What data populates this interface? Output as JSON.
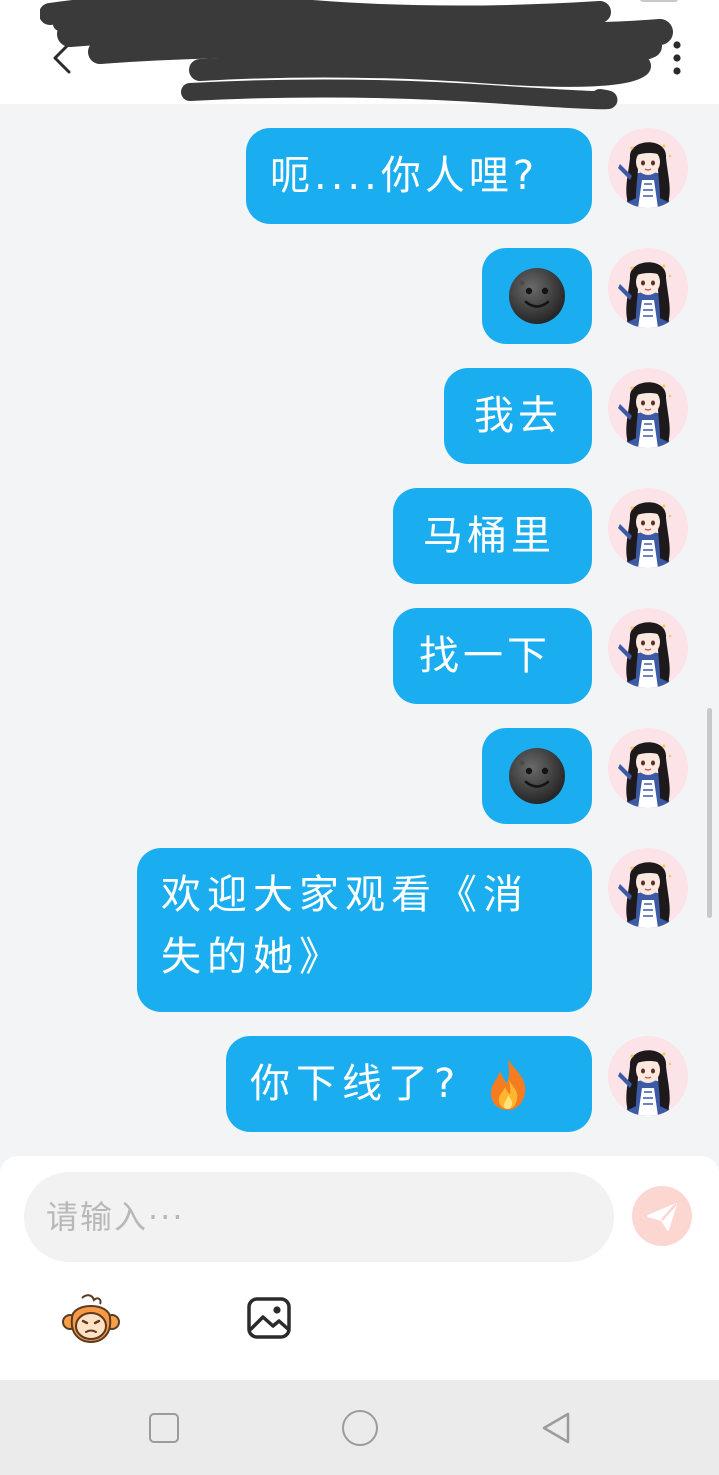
{
  "header": {
    "title": "",
    "back_icon": "chevron-left-icon",
    "menu_icon": "more-vertical-icon"
  },
  "messages": [
    {
      "type": "text",
      "text": "呃....你人哩?"
    },
    {
      "type": "emoji",
      "emoji": "new-moon-face-icon"
    },
    {
      "type": "text",
      "text": "我去"
    },
    {
      "type": "text",
      "text": "马桶里"
    },
    {
      "type": "text",
      "text": "找一下"
    },
    {
      "type": "emoji",
      "emoji": "new-moon-face-icon"
    },
    {
      "type": "text",
      "text": "欢迎大家观看《消失的她》"
    },
    {
      "type": "text",
      "text": "你下线了?",
      "emoji": "fire-icon"
    }
  ],
  "composer": {
    "placeholder": "请输入···",
    "send_icon": "paper-plane-icon",
    "sticker_icon": "monkey-sticker-icon",
    "image_icon": "image-gallery-icon"
  },
  "system_nav": {
    "recent_icon": "square-icon",
    "home_icon": "circle-icon",
    "back_icon": "triangle-back-icon"
  },
  "colors": {
    "bubble": "#1aaef0",
    "background": "#f3f4f5",
    "send_button": "#fcd7d2"
  }
}
